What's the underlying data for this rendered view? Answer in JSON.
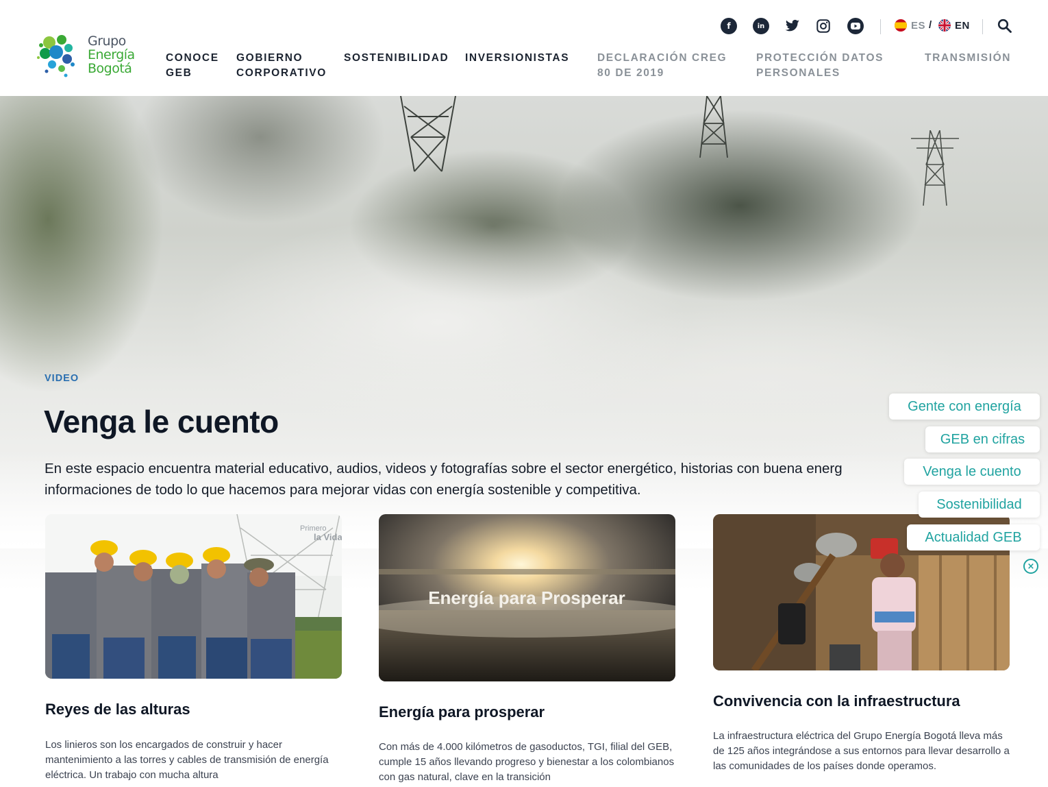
{
  "logo": {
    "line1": "Grupo",
    "line2": "Energía",
    "line3": "Bogotá"
  },
  "nav": [
    {
      "line1": "CONOCE",
      "line2": "GEB",
      "muted": false
    },
    {
      "line1": "GOBIERNO",
      "line2": "CORPORATIVO",
      "muted": false
    },
    {
      "line1": "SOSTENIBILIDAD",
      "line2": "",
      "muted": false
    },
    {
      "line1": "INVERSIONISTAS",
      "line2": "",
      "muted": false
    },
    {
      "line1": "DECLARACIÓN CREG",
      "line2": "80 DE 2019",
      "muted": true
    },
    {
      "line1": "PROTECCIÓN DATOS",
      "line2": "PERSONALES",
      "muted": true
    },
    {
      "line1": "TRANSMISIÓN",
      "line2": "",
      "muted": true
    }
  ],
  "social": [
    "facebook-icon",
    "linkedin-icon",
    "twitter-icon",
    "instagram-icon",
    "youtube-icon"
  ],
  "language": {
    "es": "ES",
    "separator": "/",
    "en": "EN",
    "active": "EN"
  },
  "hero": {
    "eyebrow": "VIDEO",
    "title": "Venga le cuento",
    "intro_line1": "En este espacio encuentra material educativo, audios, videos y fotografías sobre el sector energético, historias con buena energ",
    "intro_line2": "informaciones de todo lo que hacemos para mejorar vidas con energía sostenible y competitiva."
  },
  "cards": [
    {
      "title": "Reyes de las alturas",
      "text": "Los linieros son los encargados de construir y hacer mantenimiento a las torres y cables de transmisión de energía eléctrica. Un trabajo con mucha altura",
      "image_watermark": "Primero la Vida"
    },
    {
      "title": "Energía para prosperar",
      "text": "Con más de 4.000 kilómetros de gasoductos, TGI, filial del GEB, cumple 15 años llevando progreso y bienestar a los colombianos con gas natural, clave en la transición",
      "image_caption": "Energía para Prosperar"
    },
    {
      "title": "Convivencia con la infraestructura",
      "text": "La infraestructura eléctrica del Grupo Energía Bogotá lleva más de 125 años integrándose a sus entornos para llevar desarrollo a las comunidades de los países donde operamos."
    }
  ],
  "side_menu": [
    "Gente con energía",
    "GEB en cifras",
    "Venga le cuento",
    "Sostenibilidad",
    "Actualidad GEB"
  ],
  "colors": {
    "accent_teal": "#20a3a0",
    "eyebrow_blue": "#2a6fb0",
    "brand_green": "#3aa935",
    "navy": "#1b2330"
  }
}
